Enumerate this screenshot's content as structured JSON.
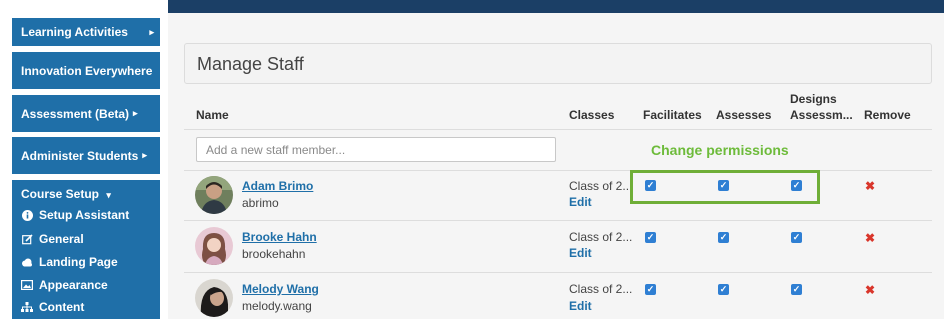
{
  "sidebar": {
    "items": [
      {
        "label": "Learning Activities"
      },
      {
        "label": "Innovation Everywhere"
      },
      {
        "label": "Assessment (Beta)"
      },
      {
        "label": "Administer Students"
      },
      {
        "label": "Course Setup"
      }
    ],
    "course_setup_items": [
      {
        "label": "Setup Assistant",
        "icon": "info-circle-icon"
      },
      {
        "label": "General",
        "icon": "edit-icon"
      },
      {
        "label": "Landing Page",
        "icon": "cloud-icon"
      },
      {
        "label": "Appearance",
        "icon": "image-icon"
      },
      {
        "label": "Content",
        "icon": "sitemap-icon"
      }
    ]
  },
  "main": {
    "title": "Manage Staff",
    "columns": {
      "name": "Name",
      "classes": "Classes",
      "facilitates": "Facilitates",
      "assesses": "Assesses",
      "designs_line1": "Designs",
      "designs_line2": "Assessm...",
      "remove": "Remove"
    },
    "add_placeholder": "Add a new staff member...",
    "annotation": "Change permissions",
    "staff": [
      {
        "name": "Adam Brimo",
        "login": "abrimo",
        "classes": "Class of 2...",
        "edit": "Edit",
        "facilitates": true,
        "assesses": true,
        "designs": true
      },
      {
        "name": "Brooke Hahn",
        "login": "brookehahn",
        "classes": "Class of 2...",
        "edit": "Edit",
        "facilitates": true,
        "assesses": true,
        "designs": true
      },
      {
        "name": "Melody Wang",
        "login": "melody.wang",
        "classes": "Class of 2...",
        "edit": "Edit",
        "facilitates": true,
        "assesses": true,
        "designs": true
      }
    ]
  },
  "colors": {
    "sidebar": "#1f6fa8",
    "link": "#1f6fa8",
    "checkbox": "#2f7fd3",
    "annotation": "#6dbb3a",
    "remove": "#d9362b",
    "topbar": "#1b3f66"
  }
}
